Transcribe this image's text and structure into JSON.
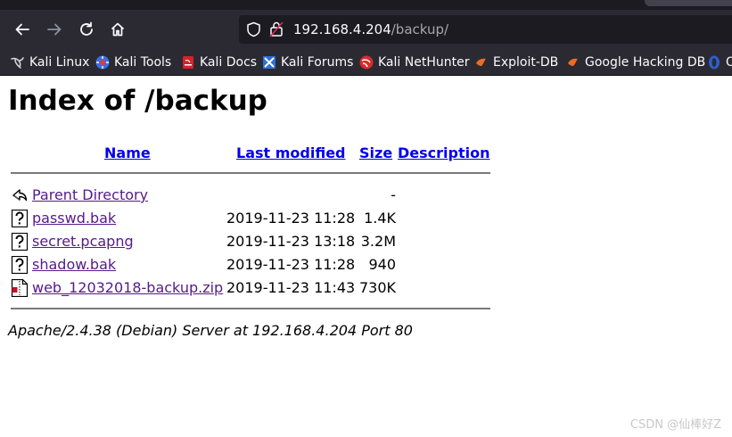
{
  "browser": {
    "url_host": "192.168.4.204",
    "url_path": "/backup/"
  },
  "bookmarks": [
    {
      "label": "Kali Linux",
      "icon": "kali-dragon-icon"
    },
    {
      "label": "Kali Tools",
      "icon": "kali-tools-icon"
    },
    {
      "label": "Kali Docs",
      "icon": "kali-docs-icon"
    },
    {
      "label": "Kali Forums",
      "icon": "kali-forums-icon"
    },
    {
      "label": "Kali NetHunter",
      "icon": "kali-nethunter-icon"
    },
    {
      "label": "Exploit-DB",
      "icon": "exploit-db-icon"
    },
    {
      "label": "Google Hacking DB",
      "icon": "ghdb-icon"
    },
    {
      "label": "O",
      "icon": "offsec-icon"
    }
  ],
  "page": {
    "title": "Index of /backup",
    "columns": {
      "name": "Name",
      "modified": "Last modified",
      "size": "Size",
      "description": "Description"
    },
    "rows": [
      {
        "name": "Parent Directory",
        "modified": "",
        "size": "-",
        "icon": "back-arrow-icon"
      },
      {
        "name": "passwd.bak",
        "modified": "2019-11-23 11:28",
        "size": "1.4K",
        "icon": "unknown-file-icon"
      },
      {
        "name": "secret.pcapng",
        "modified": "2019-11-23 13:18",
        "size": "3.2M",
        "icon": "unknown-file-icon"
      },
      {
        "name": "shadow.bak",
        "modified": "2019-11-23 11:28",
        "size": "940",
        "icon": "unknown-file-icon"
      },
      {
        "name": "web_12032018-backup.zip",
        "modified": "2019-11-23 11:43",
        "size": "730K",
        "icon": "compressed-file-icon"
      }
    ],
    "server_signature": "Apache/2.4.38 (Debian) Server at 192.168.4.204 Port 80"
  },
  "watermark": "CSDN @仙棒好Z",
  "colors": {
    "toolbar": "#2b2a33",
    "link": "#0000ee",
    "visited": "#551a8b"
  }
}
